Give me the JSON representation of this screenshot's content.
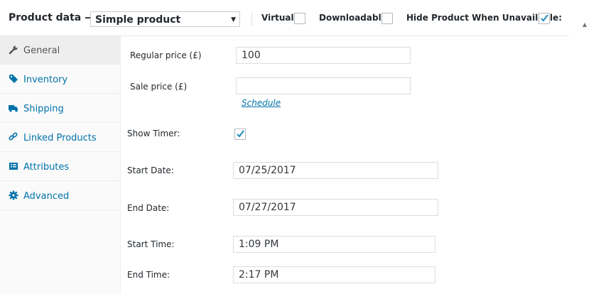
{
  "header": {
    "title": "Product data —",
    "product_type": "Simple product",
    "virtual_label": "Virtual:",
    "virtual_checked": false,
    "downloadable_label": "Downloadable:",
    "downloadable_checked": false,
    "hide_label": "Hide Product When Unavailable:",
    "hide_checked": true
  },
  "tabs": [
    {
      "label": "General",
      "icon": "wrench-icon",
      "active": true
    },
    {
      "label": "Inventory",
      "icon": "tag-icon",
      "active": false
    },
    {
      "label": "Shipping",
      "icon": "truck-icon",
      "active": false
    },
    {
      "label": "Linked Products",
      "icon": "link-icon",
      "active": false
    },
    {
      "label": "Attributes",
      "icon": "list-icon",
      "active": false
    },
    {
      "label": "Advanced",
      "icon": "gear-icon",
      "active": false
    }
  ],
  "fields": {
    "regular_price_label": "Regular price (£)",
    "regular_price_value": "100",
    "sale_price_label": "Sale price (£)",
    "sale_price_value": "",
    "schedule_link": "Schedule",
    "show_timer_label": "Show Timer:",
    "show_timer_checked": true,
    "start_date_label": "Start Date:",
    "start_date_value": "07/25/2017",
    "end_date_label": "End Date:",
    "end_date_value": "07/27/2017",
    "start_time_label": "Start Time:",
    "start_time_value": "1:09 PM",
    "end_time_label": "End Time:",
    "end_time_value": "2:17 PM"
  },
  "colors": {
    "link": "#0073aa",
    "check": "#1e8cbe"
  }
}
